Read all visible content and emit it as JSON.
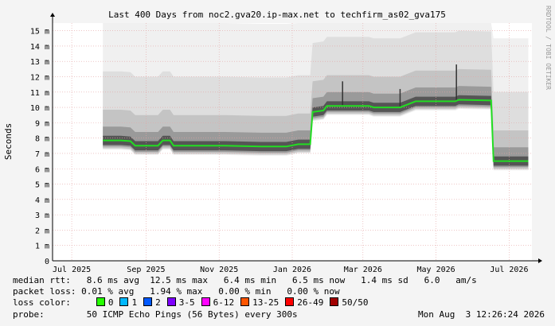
{
  "chart_data": {
    "type": "line",
    "title": "Last 400 Days from noc2.gva20.ip-max.net to techfirm_as02_gva175",
    "ylabel": "Seconds",
    "watermark": "RRDTOOL / TOBI OETIKER",
    "ylim": [
      0,
      15.5
    ],
    "yticks": [
      0,
      1,
      2,
      3,
      4,
      5,
      6,
      7,
      8,
      9,
      10,
      11,
      12,
      13,
      14,
      15
    ],
    "ytick_labels": [
      "0",
      "1 m",
      "2 m",
      "3 m",
      "4 m",
      "5 m",
      "6 m",
      "7 m",
      "8 m",
      "9 m",
      "10 m",
      "11 m",
      "12 m",
      "13 m",
      "14 m",
      "15 m"
    ],
    "x_domain": [
      "2025-06-29",
      "2026-08-03"
    ],
    "xticks": [
      {
        "date": "2025-07-15",
        "label": "Jul 2025"
      },
      {
        "date": "2025-09-15",
        "label": "Sep 2025"
      },
      {
        "date": "2025-11-15",
        "label": "Nov 2025"
      },
      {
        "date": "2026-01-15",
        "label": "Jan 2026"
      },
      {
        "date": "2026-03-15",
        "label": "Mar 2026"
      },
      {
        "date": "2026-05-15",
        "label": "May 2026"
      },
      {
        "date": "2026-07-15",
        "label": "Jul 2026"
      }
    ],
    "grid": true,
    "series": [
      {
        "name": "median rtt",
        "color": "#22dd22",
        "points": [
          {
            "x": "2025-08-10",
            "y": 7.85
          },
          {
            "x": "2025-08-25",
            "y": 7.85
          },
          {
            "x": "2025-09-02",
            "y": 7.8
          },
          {
            "x": "2025-09-06",
            "y": 7.5
          },
          {
            "x": "2025-09-25",
            "y": 7.5
          },
          {
            "x": "2025-09-29",
            "y": 7.85
          },
          {
            "x": "2025-10-05",
            "y": 7.85
          },
          {
            "x": "2025-10-08",
            "y": 7.5
          },
          {
            "x": "2025-11-20",
            "y": 7.5
          },
          {
            "x": "2025-12-20",
            "y": 7.45
          },
          {
            "x": "2026-01-10",
            "y": 7.45
          },
          {
            "x": "2026-01-20",
            "y": 7.6
          },
          {
            "x": "2026-01-30",
            "y": 7.6
          },
          {
            "x": "2026-02-01",
            "y": 9.7
          },
          {
            "x": "2026-02-10",
            "y": 9.8
          },
          {
            "x": "2026-02-13",
            "y": 10.1
          },
          {
            "x": "2026-03-20",
            "y": 10.1
          },
          {
            "x": "2026-03-24",
            "y": 10.0
          },
          {
            "x": "2026-04-15",
            "y": 10.0
          },
          {
            "x": "2026-04-28",
            "y": 10.4
          },
          {
            "x": "2026-05-31",
            "y": 10.4
          },
          {
            "x": "2026-06-03",
            "y": 10.5
          },
          {
            "x": "2026-06-30",
            "y": 10.45
          },
          {
            "x": "2026-07-02",
            "y": 6.5
          },
          {
            "x": "2026-07-31",
            "y": 6.5
          }
        ]
      }
    ],
    "spikes": [
      {
        "x": "2026-02-26",
        "y": 11.7
      },
      {
        "x": "2026-04-15",
        "y": 11.2
      },
      {
        "x": "2026-06-01",
        "y": 12.8
      }
    ]
  },
  "stats": {
    "median_label": "median rtt:",
    "median_values": "   8.6 ms avg  12.5 ms max   6.4 ms min   6.5 ms now   1.4 ms sd   6.0   am/s",
    "loss_label": "packet loss:",
    "loss_values": " 0.01 % avg   1.94 % max   0.00 % min   0.00 % now",
    "color_label": "loss color:",
    "probe_label": "probe:",
    "probe_text": "        50 ICMP Echo Pings (56 Bytes) every 300s",
    "timestamp": "Mon Aug  3 12:26:24 2026"
  },
  "loss_colors": [
    {
      "label": "0",
      "color": "#26ff00"
    },
    {
      "label": "1",
      "color": "#00b8ff"
    },
    {
      "label": "2",
      "color": "#0059ff"
    },
    {
      "label": "3-5",
      "color": "#7e00ff"
    },
    {
      "label": "6-12",
      "color": "#ff00ff"
    },
    {
      "label": "13-25",
      "color": "#ff5500"
    },
    {
      "label": "26-49",
      "color": "#ff0000"
    },
    {
      "label": "50/50",
      "color": "#a10000"
    }
  ]
}
